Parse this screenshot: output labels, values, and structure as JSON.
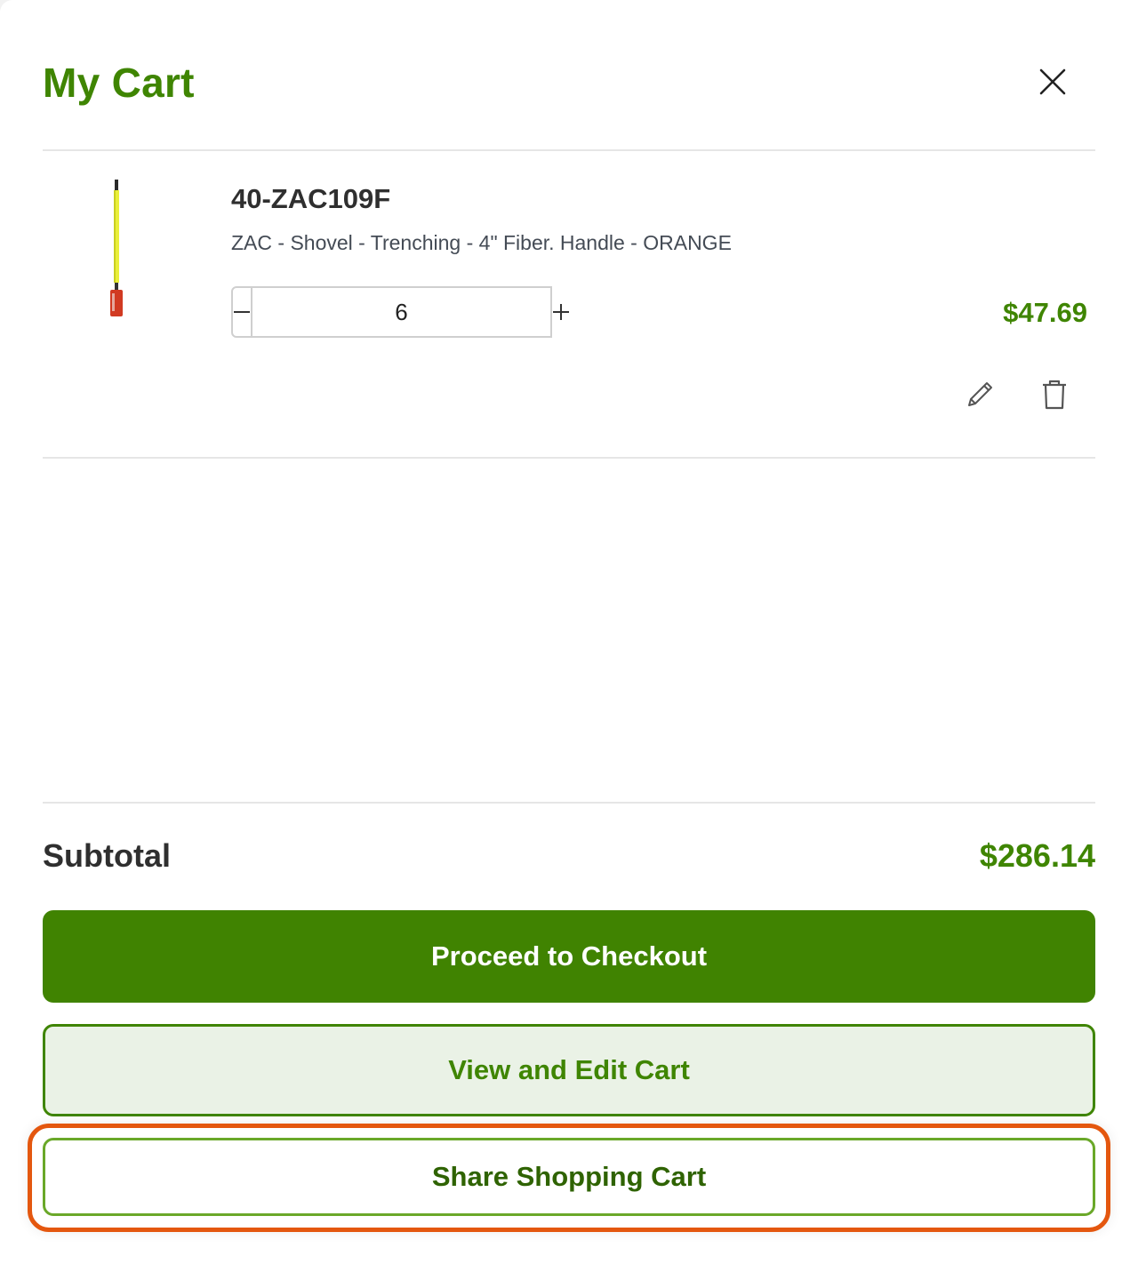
{
  "cart": {
    "title": "My Cart",
    "close_icon": "close-icon"
  },
  "item": {
    "sku": "40-ZAC109F",
    "description": "ZAC - Shovel - Trenching - 4\" Fiber. Handle - ORANGE",
    "quantity": "6",
    "price": "$47.69",
    "thumbnail": "trenching-shovel-image",
    "edit_icon": "pencil-icon",
    "delete_icon": "trash-icon"
  },
  "summary": {
    "subtotal_label": "Subtotal",
    "subtotal_value": "$286.14"
  },
  "actions": {
    "checkout_label": "Proceed to Checkout",
    "view_edit_label": "View and Edit Cart",
    "share_label": "Share Shopping Cart"
  },
  "colors": {
    "brand_green": "#3f8502",
    "highlight_orange": "#e4570f"
  }
}
